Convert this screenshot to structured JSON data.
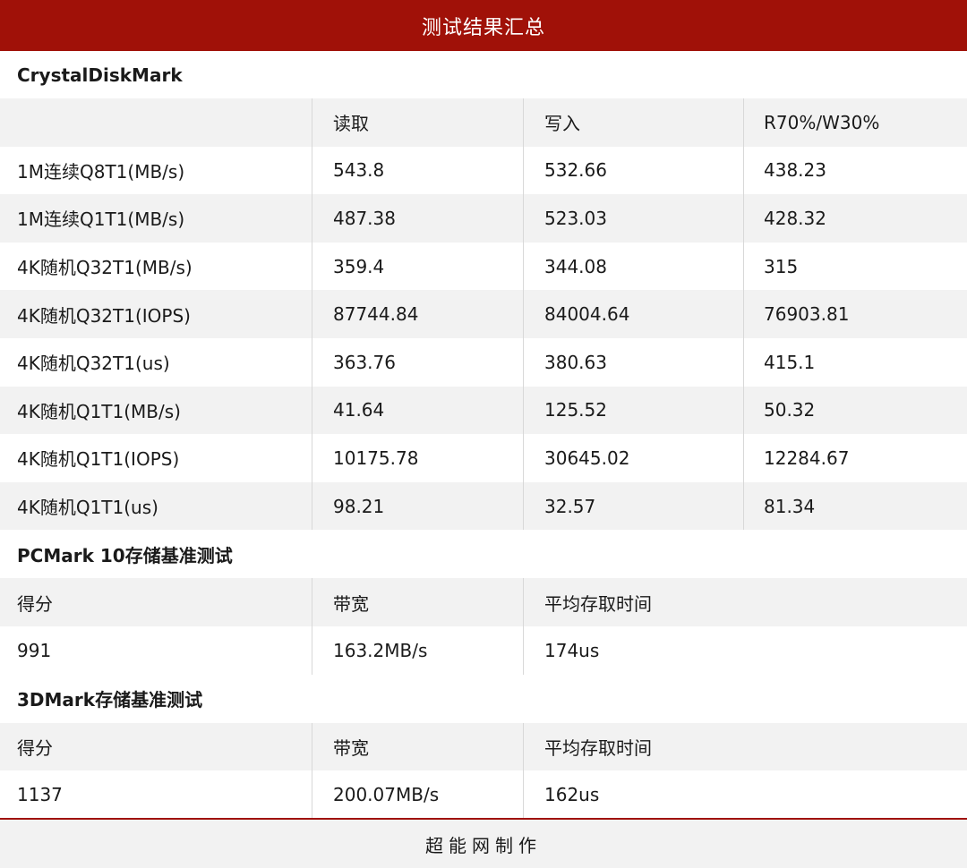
{
  "header": {
    "title": "测试结果汇总"
  },
  "crystaldiskmark": {
    "title": "CrystalDiskMark",
    "columns": [
      "",
      "读取",
      "写入",
      "R70%/W30%"
    ],
    "rows": [
      [
        "1M连续Q8T1(MB/s)",
        "543.8",
        "532.66",
        "438.23"
      ],
      [
        "1M连续Q1T1(MB/s)",
        "487.38",
        "523.03",
        "428.32"
      ],
      [
        "4K随机Q32T1(MB/s)",
        "359.4",
        "344.08",
        "315"
      ],
      [
        "4K随机Q32T1(IOPS)",
        "87744.84",
        "84004.64",
        "76903.81"
      ],
      [
        "4K随机Q32T1(us)",
        "363.76",
        "380.63",
        "415.1"
      ],
      [
        "4K随机Q1T1(MB/s)",
        "41.64",
        "125.52",
        "50.32"
      ],
      [
        "4K随机Q1T1(IOPS)",
        "10175.78",
        "30645.02",
        "12284.67"
      ],
      [
        "4K随机Q1T1(us)",
        "98.21",
        "32.57",
        "81.34"
      ]
    ]
  },
  "pcmark": {
    "title": "PCMark 10存储基准测试",
    "columns": [
      "得分",
      "带宽",
      "平均存取时间"
    ],
    "values": [
      "991",
      "163.2MB/s",
      "174us"
    ]
  },
  "threedmark": {
    "title": "3DMark存储基准测试",
    "columns": [
      "得分",
      "带宽",
      "平均存取时间"
    ],
    "values": [
      "1137",
      "200.07MB/s",
      "162us"
    ]
  },
  "footer": {
    "text": "超能网制作"
  }
}
